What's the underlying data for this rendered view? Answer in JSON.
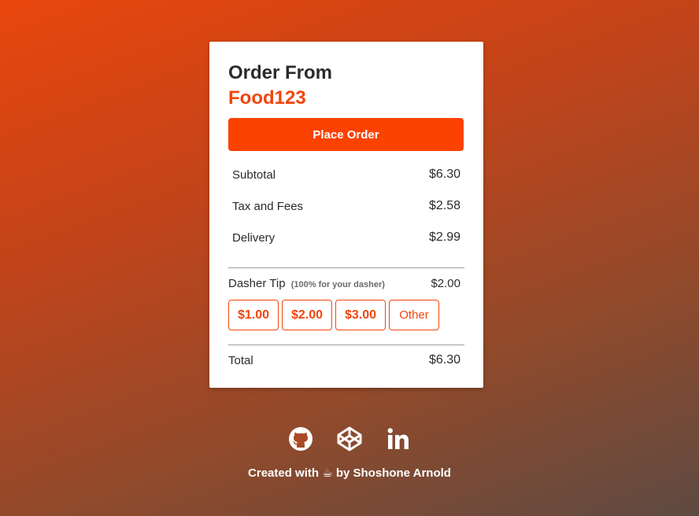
{
  "order": {
    "title": "Order From",
    "restaurant": "Food123",
    "place_order_label": "Place Order"
  },
  "line_items": [
    {
      "label": "Subtotal",
      "amount": "$6.30"
    },
    {
      "label": "Tax and Fees",
      "amount": "$2.58"
    },
    {
      "label": "Delivery",
      "amount": "$2.99"
    }
  ],
  "tip": {
    "label": "Dasher Tip",
    "note": "(100% for your dasher)",
    "amount": "$2.00",
    "options": [
      "$1.00",
      "$2.00",
      "$3.00",
      "Other"
    ]
  },
  "total": {
    "label": "Total",
    "amount": "$6.30"
  },
  "footer": {
    "credit_prefix": "Created with",
    "credit_icon": "☕",
    "credit_suffix": "by Shoshone Arnold",
    "social_icons": [
      "github-icon",
      "codepen-icon",
      "linkedin-icon"
    ]
  },
  "colors": {
    "accent": "#fc4201",
    "accent_text": "#f2450d",
    "card_bg": "#ffffff"
  }
}
